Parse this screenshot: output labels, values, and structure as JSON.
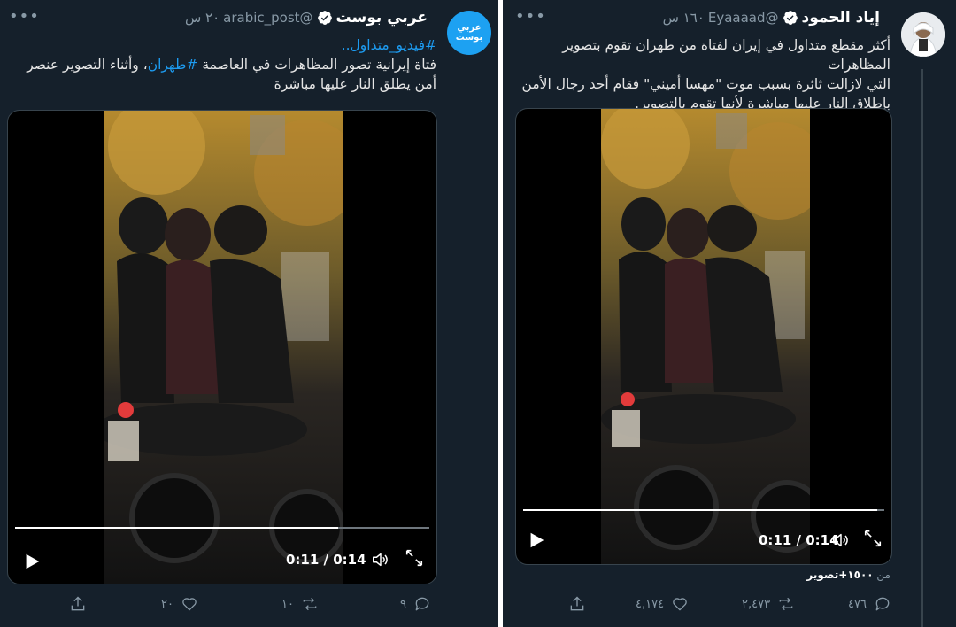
{
  "left_tweet": {
    "name": "عربي بوست",
    "handle": "@arabic_post",
    "time": "٢٠ س",
    "avatar_text": "عربي بوست",
    "hashtag_line": "#فيديو_متداول..",
    "text_line1_a": "فتاة إيرانية تصور المظاهرات في العاصمة ",
    "text_line1_tag": "#طهران",
    "text_line1_b": "، وأثناء التصوير عنصر",
    "text_line2": "أمن يطلق النار عليها مباشرة",
    "video": {
      "time": "0:11 / 0:14",
      "progress": 0.78
    },
    "actions": {
      "reply": "٩",
      "retweet": "١٠",
      "like": "٢٠",
      "share": ""
    }
  },
  "right_tweet": {
    "name": "إياد الحمود",
    "handle": "@Eyaaaad",
    "time": "١٦٠ س",
    "text_line1": "أكثر مقطع متداول في إيران لفتاة من طهران تقوم بتصوير المظاهرات",
    "text_line2": "التي لازالت ثائرة بسبب موت \"مهسا أميني\" فقام أحد رجال الأمن",
    "text_line3": "بإطلاق النار عليها مباشرة لأنها تقوم بالتصوير.",
    "video": {
      "time": "0:11 / 0:14",
      "progress": 0.98
    },
    "source_prefix": "من ",
    "source_text": "١٥٠٠+تصوير",
    "actions": {
      "reply": "٤٧٦",
      "retweet": "٢,٤٧٣",
      "like": "٤,١٧٤",
      "share": ""
    }
  },
  "icons": {
    "more": "more-icon",
    "verified": "verified-badge-icon",
    "play": "play-icon",
    "volume": "volume-icon",
    "fullscreen": "fullscreen-icon",
    "reply": "reply-icon",
    "retweet": "retweet-icon",
    "like": "like-icon",
    "share": "share-icon"
  },
  "colors": {
    "background": "#15202b",
    "link": "#1d9bf0",
    "muted": "#8899a6",
    "verified": "#ffffff",
    "avatar_bg": "#1da1f2"
  }
}
